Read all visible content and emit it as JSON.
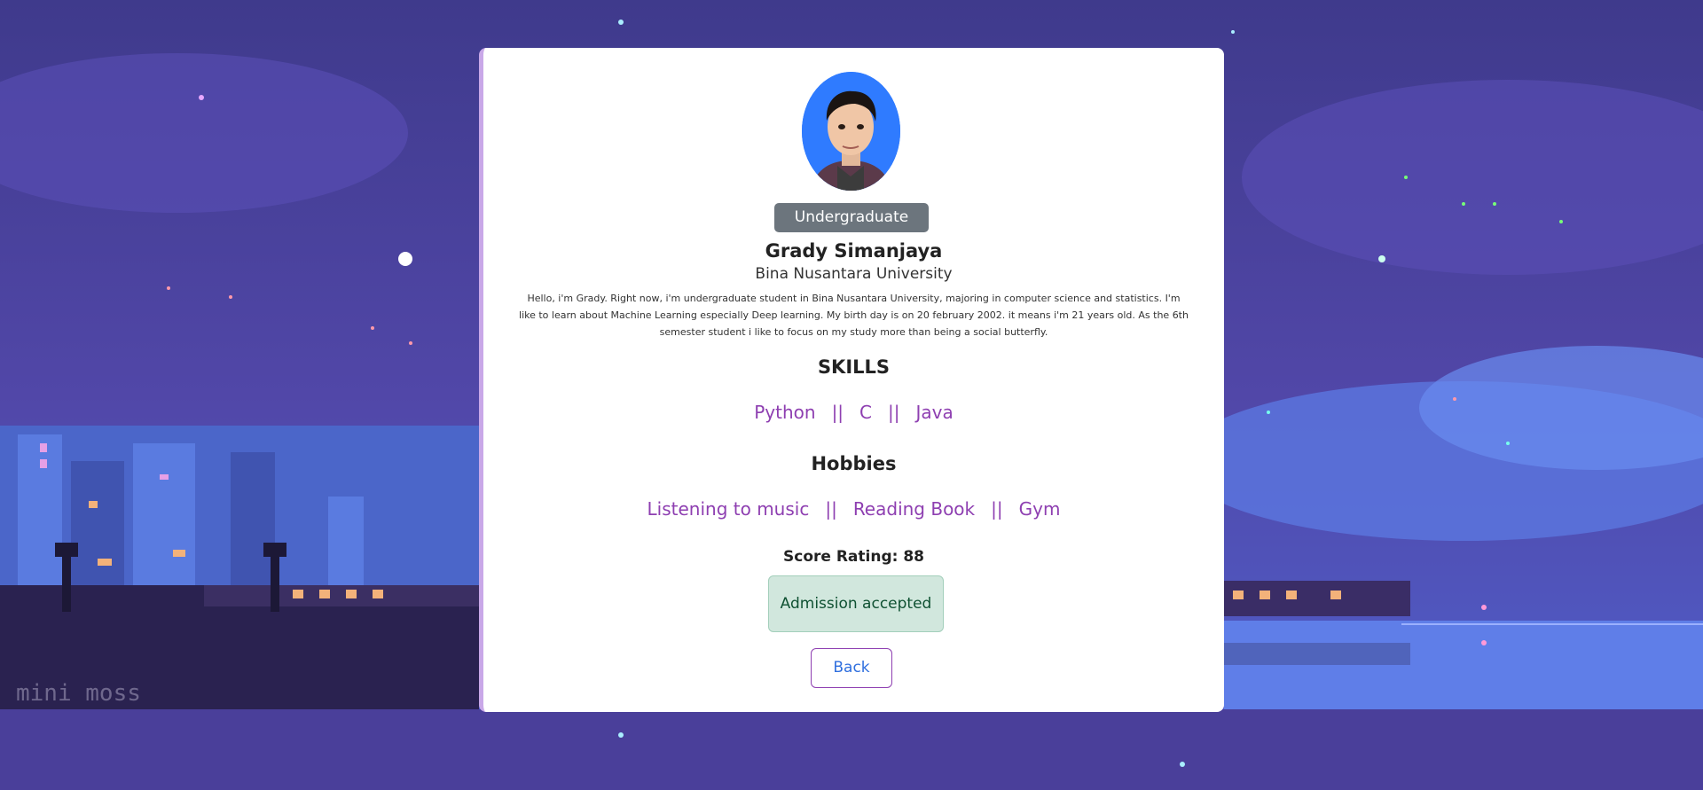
{
  "profile": {
    "badge": "Undergraduate",
    "name": "Grady Simanjaya",
    "university": "Bina Nusantara University",
    "bio": "Hello, i'm Grady. Right now, i'm undergraduate student in Bina Nusantara University, majoring in computer science and statistics. I'm like to learn about Machine Learning especially Deep learning. My birth day is on 20 february 2002. it means i'm 21 years old. As the 6th semester student i like to focus on my study more than being a social butterfly."
  },
  "skills": {
    "heading": "SKILLS",
    "items": [
      "Python",
      "C",
      "Java"
    ],
    "separator": "||"
  },
  "hobbies": {
    "heading": "Hobbies",
    "items": [
      "Listening to music",
      "Reading Book",
      "Gym"
    ],
    "separator": "||"
  },
  "score": {
    "text": "Score Rating: 88"
  },
  "status": {
    "text": "Admission accepted"
  },
  "actions": {
    "back_label": "Back"
  },
  "background": {
    "watermark": "mini moss"
  }
}
